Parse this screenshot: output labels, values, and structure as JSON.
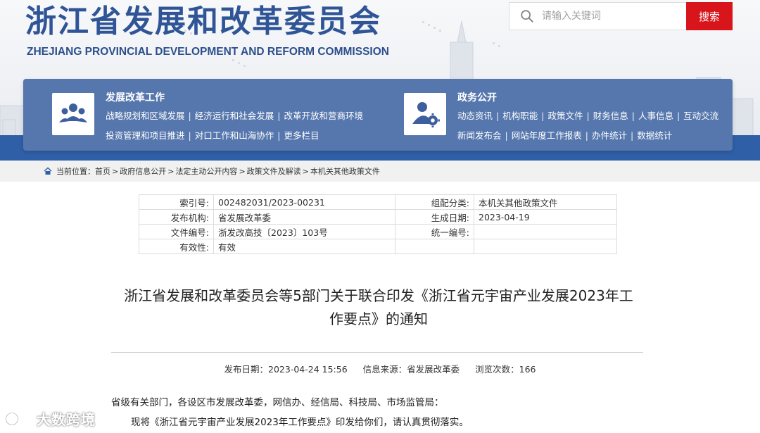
{
  "site": {
    "title": "浙江省发展和改革委员会",
    "subtitle": "ZHEJIANG PROVINCIAL DEVELOPMENT AND REFORM COMMISSION"
  },
  "search": {
    "placeholder": "请输入关键词",
    "button_label": "搜索"
  },
  "nav": {
    "left": {
      "heading": "发展改革工作",
      "row1": [
        "战略规划和区域发展",
        "经济运行和社会发展",
        "改革开放和营商环境"
      ],
      "row2": [
        "投资管理和项目推进",
        "对口工作和山海协作",
        "更多栏目"
      ]
    },
    "right": {
      "heading": "政务公开",
      "row1": [
        "动态资讯",
        "机构职能",
        "政策文件",
        "财务信息",
        "人事信息",
        "互动交流"
      ],
      "row2": [
        "新闻发布会",
        "网站年度工作报表",
        "办件统计",
        "数据统计"
      ]
    }
  },
  "breadcrumb": {
    "label": "当前位置：",
    "items": [
      "首页",
      "政府信息公开",
      "法定主动公开内容",
      "政策文件及解读",
      "本机关其他政策文件"
    ],
    "separator": ">"
  },
  "meta": {
    "rows": [
      {
        "k1": "索引号:",
        "v1": "002482031/2023-00231",
        "k2": "组配分类:",
        "v2": "本机关其他政策文件"
      },
      {
        "k1": "发布机构:",
        "v1": "省发展改革委",
        "k2": "生成日期:",
        "v2": "2023-04-19"
      },
      {
        "k1": "文件编号:",
        "v1": "浙发改高技〔2023〕103号",
        "k2": "统一编号:",
        "v2": ""
      },
      {
        "k1": "有效性:",
        "v1": "有效",
        "k2": "",
        "v2": ""
      }
    ]
  },
  "article": {
    "title_line1": "浙江省发展和改革委员会等5部门关于联合印发《浙江省元宇宙产业发展2023年工",
    "title_line2": "作要点》的通知",
    "pub_date_label": "发布日期：",
    "pub_date": "2023-04-24 15:56",
    "source_label": "信息来源：",
    "source": "省发展改革委",
    "views_label": "浏览次数：",
    "views": "166",
    "para1": "省级有关部门，各设区市发展改革委，网信办、经信局、科技局、市场监管局：",
    "para2": "现将《浙江省元宇宙产业发展2023年工作要点》印发给你们，请认真贯彻落实。"
  },
  "watermark": {
    "text": "大数跨境"
  },
  "colors": {
    "brand_blue": "#2f5596",
    "nav_blue": "#5677ad",
    "search_red": "#d7151b"
  },
  "icons": {
    "search": "search-icon",
    "left_nav": "people-group-icon",
    "right_nav": "user-gear-icon",
    "breadcrumb": "home-icon"
  }
}
